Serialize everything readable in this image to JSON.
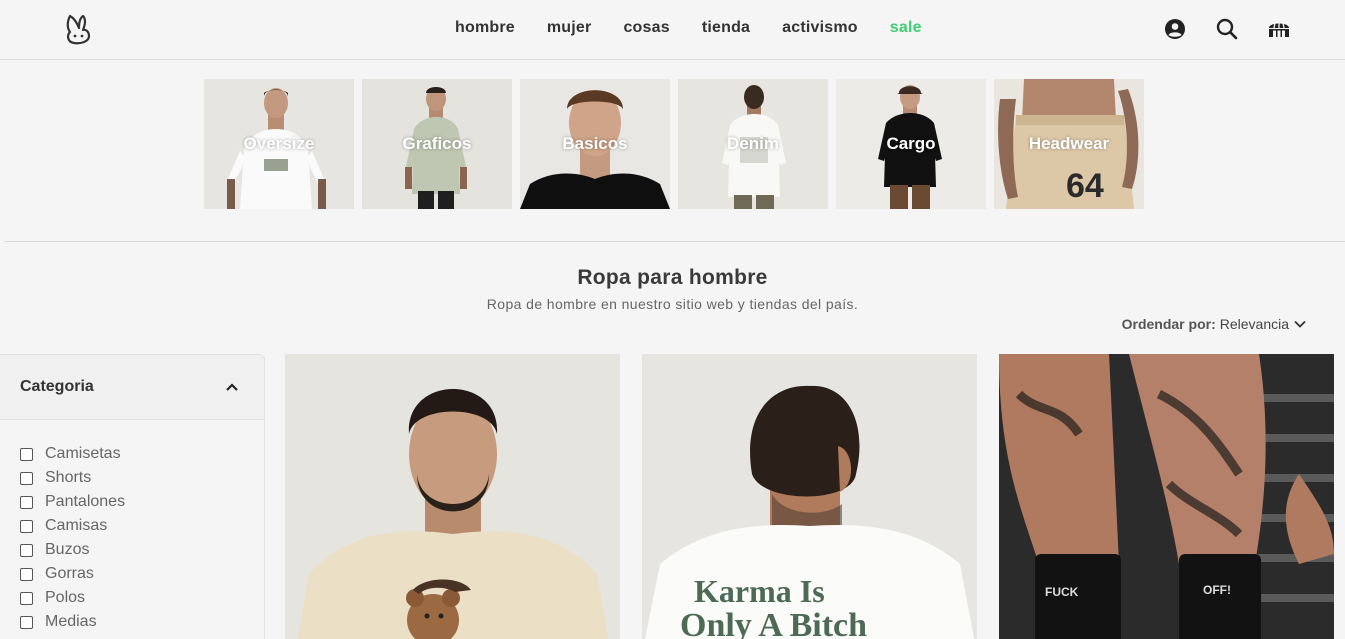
{
  "header": {
    "nav": [
      {
        "label": "hombre"
      },
      {
        "label": "mujer"
      },
      {
        "label": "cosas"
      },
      {
        "label": "tienda"
      },
      {
        "label": "activismo"
      },
      {
        "label": "sale"
      }
    ],
    "icons": [
      "user-icon",
      "search-icon",
      "store-icon"
    ],
    "sale_color": "#3ecf72"
  },
  "categories": [
    {
      "label": "Oversize"
    },
    {
      "label": "Graficos"
    },
    {
      "label": "Basicos"
    },
    {
      "label": "Denim"
    },
    {
      "label": "Cargo"
    },
    {
      "label": "Headwear"
    }
  ],
  "page": {
    "title": "Ropa para hombre",
    "subtitle": "Ropa de hombre en nuestro sitio web y tiendas del país."
  },
  "sort": {
    "label": "Ordendar por:",
    "value": "Relevancia"
  },
  "filters": {
    "title": "Categoria",
    "items": [
      "Camisetas",
      "Shorts",
      "Pantalones",
      "Camisas",
      "Buzos",
      "Gorras",
      "Polos",
      "Medias"
    ]
  },
  "products": [
    {
      "image": "man-beige-tshirt-bear-print"
    },
    {
      "image": "man-white-tshirt-back-print",
      "print_text_1": "Karma Is",
      "print_text_2": "Only A Bitch"
    },
    {
      "image": "tattooed-legs-black-socks",
      "sock_left": "FUCK",
      "sock_right": "OFF!"
    }
  ]
}
